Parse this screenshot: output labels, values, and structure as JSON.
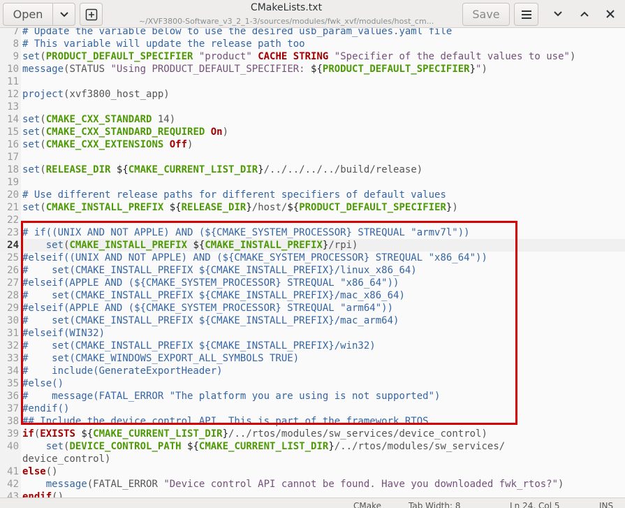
{
  "header": {
    "open_label": "Open",
    "title": "CMakeLists.txt",
    "subtitle": "~/XVF3800-Software_v3_2_1-3/sources/modules/fwk_xvf/modules/host_cm...",
    "save_label": "Save"
  },
  "status": {
    "language": "CMake",
    "tab_width": "Tab Width: 8",
    "position": "Ln 24, Col 5",
    "mode": "INS"
  },
  "editor": {
    "current_line": "24",
    "lines": [
      {
        "n": "7",
        "parts": [
          {
            "t": "c",
            "v": "# Update the variable below to use the desired usb_param_values.yaml file"
          }
        ]
      },
      {
        "n": "8",
        "parts": [
          {
            "t": "c",
            "v": "# This variable will update the release path too"
          }
        ]
      },
      {
        "n": "9",
        "parts": [
          {
            "t": "fn",
            "v": "set"
          },
          {
            "t": "p",
            "v": "("
          },
          {
            "t": "v",
            "v": "PRODUCT_DEFAULT_SPECIFIER"
          },
          {
            "t": "p",
            "v": " "
          },
          {
            "t": "s",
            "v": "\"product\""
          },
          {
            "t": "p",
            "v": " "
          },
          {
            "t": "kw",
            "v": "CACHE STRING"
          },
          {
            "t": "p",
            "v": " "
          },
          {
            "t": "s",
            "v": "\"Specifier of the default values to use\""
          },
          {
            "t": "p",
            "v": ")"
          }
        ]
      },
      {
        "n": "10",
        "parts": [
          {
            "t": "fn",
            "v": "message"
          },
          {
            "t": "p",
            "v": "(STATUS "
          },
          {
            "t": "s",
            "v": "\"Using PRODUCT_DEFAULT_SPECIFIER: "
          },
          {
            "t": "vt",
            "v": "${"
          },
          {
            "t": "v",
            "v": "PRODUCT_DEFAULT_SPECIFIER"
          },
          {
            "t": "vt",
            "v": "}"
          },
          {
            "t": "s",
            "v": "\""
          },
          {
            "t": "p",
            "v": ")"
          }
        ]
      },
      {
        "n": "11",
        "parts": []
      },
      {
        "n": "12",
        "parts": [
          {
            "t": "fn",
            "v": "project"
          },
          {
            "t": "p",
            "v": "(xvf3800_host_app)"
          }
        ]
      },
      {
        "n": "13",
        "parts": []
      },
      {
        "n": "14",
        "parts": [
          {
            "t": "fn",
            "v": "set"
          },
          {
            "t": "p",
            "v": "("
          },
          {
            "t": "v",
            "v": "CMAKE_CXX_STANDARD"
          },
          {
            "t": "p",
            "v": " 14)"
          }
        ]
      },
      {
        "n": "15",
        "parts": [
          {
            "t": "fn",
            "v": "set"
          },
          {
            "t": "p",
            "v": "("
          },
          {
            "t": "v",
            "v": "CMAKE_CXX_STANDARD_REQUIRED"
          },
          {
            "t": "p",
            "v": " "
          },
          {
            "t": "kw",
            "v": "On"
          },
          {
            "t": "p",
            "v": ")"
          }
        ]
      },
      {
        "n": "16",
        "parts": [
          {
            "t": "fn",
            "v": "set"
          },
          {
            "t": "p",
            "v": "("
          },
          {
            "t": "v",
            "v": "CMAKE_CXX_EXTENSIONS"
          },
          {
            "t": "p",
            "v": " "
          },
          {
            "t": "kw",
            "v": "Off"
          },
          {
            "t": "p",
            "v": ")"
          }
        ]
      },
      {
        "n": "17",
        "parts": []
      },
      {
        "n": "18",
        "parts": [
          {
            "t": "fn",
            "v": "set"
          },
          {
            "t": "p",
            "v": "("
          },
          {
            "t": "v",
            "v": "RELEASE_DIR"
          },
          {
            "t": "p",
            "v": " "
          },
          {
            "t": "vt",
            "v": "${"
          },
          {
            "t": "v",
            "v": "CMAKE_CURRENT_LIST_DIR"
          },
          {
            "t": "vt",
            "v": "}"
          },
          {
            "t": "p",
            "v": "/../../../../build/release)"
          }
        ]
      },
      {
        "n": "19",
        "parts": []
      },
      {
        "n": "20",
        "parts": [
          {
            "t": "c",
            "v": "# Use different release paths for different specifiers of default values"
          }
        ]
      },
      {
        "n": "21",
        "parts": [
          {
            "t": "fn",
            "v": "set"
          },
          {
            "t": "p",
            "v": "("
          },
          {
            "t": "v",
            "v": "CMAKE_INSTALL_PREFIX"
          },
          {
            "t": "p",
            "v": " "
          },
          {
            "t": "vt",
            "v": "${"
          },
          {
            "t": "v",
            "v": "RELEASE_DIR"
          },
          {
            "t": "vt",
            "v": "}"
          },
          {
            "t": "p",
            "v": "/host/"
          },
          {
            "t": "vt",
            "v": "${"
          },
          {
            "t": "v",
            "v": "PRODUCT_DEFAULT_SPECIFIER"
          },
          {
            "t": "vt",
            "v": "}"
          },
          {
            "t": "p",
            "v": ")"
          }
        ]
      },
      {
        "n": "22",
        "parts": []
      },
      {
        "n": "23",
        "parts": [
          {
            "t": "c",
            "v": "# if((UNIX AND NOT APPLE) AND (${CMAKE_SYSTEM_PROCESSOR} STREQUAL \"armv7l\"))"
          }
        ]
      },
      {
        "n": "24",
        "parts": [
          {
            "t": "p",
            "v": "    "
          },
          {
            "t": "fn",
            "v": "set"
          },
          {
            "t": "p",
            "v": "("
          },
          {
            "t": "v",
            "v": "CMAKE_INSTALL_PREFIX"
          },
          {
            "t": "p",
            "v": " "
          },
          {
            "t": "vt",
            "v": "${"
          },
          {
            "t": "v",
            "v": "CMAKE_INSTALL_PREFIX"
          },
          {
            "t": "vt",
            "v": "}"
          },
          {
            "t": "p",
            "v": "/rpi)"
          }
        ]
      },
      {
        "n": "25",
        "parts": [
          {
            "t": "c",
            "v": "#elseif((UNIX AND NOT APPLE) AND (${CMAKE_SYSTEM_PROCESSOR} STREQUAL \"x86_64\"))"
          }
        ]
      },
      {
        "n": "26",
        "parts": [
          {
            "t": "c",
            "v": "#    set(CMAKE_INSTALL_PREFIX ${CMAKE_INSTALL_PREFIX}/linux_x86_64)"
          }
        ]
      },
      {
        "n": "27",
        "parts": [
          {
            "t": "c",
            "v": "#elseif(APPLE AND (${CMAKE_SYSTEM_PROCESSOR} STREQUAL \"x86_64\"))"
          }
        ]
      },
      {
        "n": "28",
        "parts": [
          {
            "t": "c",
            "v": "#    set(CMAKE_INSTALL_PREFIX ${CMAKE_INSTALL_PREFIX}/mac_x86_64)"
          }
        ]
      },
      {
        "n": "29",
        "parts": [
          {
            "t": "c",
            "v": "#elseif(APPLE AND (${CMAKE_SYSTEM_PROCESSOR} STREQUAL \"arm64\"))"
          }
        ]
      },
      {
        "n": "30",
        "parts": [
          {
            "t": "c",
            "v": "#    set(CMAKE_INSTALL_PREFIX ${CMAKE_INSTALL_PREFIX}/mac_arm64)"
          }
        ]
      },
      {
        "n": "31",
        "parts": [
          {
            "t": "c",
            "v": "#elseif(WIN32)"
          }
        ]
      },
      {
        "n": "32",
        "parts": [
          {
            "t": "c",
            "v": "#    set(CMAKE_INSTALL_PREFIX ${CMAKE_INSTALL_PREFIX}/win32)"
          }
        ]
      },
      {
        "n": "33",
        "parts": [
          {
            "t": "c",
            "v": "#    set(CMAKE_WINDOWS_EXPORT_ALL_SYMBOLS TRUE)"
          }
        ]
      },
      {
        "n": "34",
        "parts": [
          {
            "t": "c",
            "v": "#    include(GenerateExportHeader)"
          }
        ]
      },
      {
        "n": "35",
        "parts": [
          {
            "t": "c",
            "v": "#else()"
          }
        ]
      },
      {
        "n": "36",
        "parts": [
          {
            "t": "c",
            "v": "#    message(FATAL_ERROR \"The platform you are using is not supported\")"
          }
        ]
      },
      {
        "n": "37",
        "parts": [
          {
            "t": "c",
            "v": "#endif()"
          }
        ]
      },
      {
        "n": "38",
        "parts": [
          {
            "t": "c",
            "v": "## Include the device control API. This is part of the framework RTOS."
          }
        ]
      },
      {
        "n": "39",
        "parts": [
          {
            "t": "kw",
            "v": "if"
          },
          {
            "t": "p",
            "v": "("
          },
          {
            "t": "kw",
            "v": "EXISTS"
          },
          {
            "t": "p",
            "v": " "
          },
          {
            "t": "vt",
            "v": "${"
          },
          {
            "t": "v",
            "v": "CMAKE_CURRENT_LIST_DIR"
          },
          {
            "t": "vt",
            "v": "}"
          },
          {
            "t": "p",
            "v": "/../rtos/modules/sw_services/device_control)"
          }
        ]
      },
      {
        "n": "40",
        "parts": [
          {
            "t": "p",
            "v": "    "
          },
          {
            "t": "fn",
            "v": "set"
          },
          {
            "t": "p",
            "v": "("
          },
          {
            "t": "v",
            "v": "DEVICE_CONTROL_PATH"
          },
          {
            "t": "p",
            "v": " "
          },
          {
            "t": "vt",
            "v": "${"
          },
          {
            "t": "v",
            "v": "CMAKE_CURRENT_LIST_DIR"
          },
          {
            "t": "vt",
            "v": "}"
          },
          {
            "t": "p",
            "v": "/../rtos/modules/sw_services/"
          }
        ]
      },
      {
        "n": "",
        "parts": [
          {
            "t": "p",
            "v": "device_control)"
          }
        ]
      },
      {
        "n": "41",
        "parts": [
          {
            "t": "kw",
            "v": "else"
          },
          {
            "t": "p",
            "v": "()"
          }
        ]
      },
      {
        "n": "42",
        "parts": [
          {
            "t": "p",
            "v": "    "
          },
          {
            "t": "fn",
            "v": "message"
          },
          {
            "t": "p",
            "v": "(FATAL_ERROR "
          },
          {
            "t": "s",
            "v": "\"Device control API cannot be found. Have you downloaded fwk_rtos?\""
          },
          {
            "t": "p",
            "v": ")"
          }
        ]
      },
      {
        "n": "43",
        "parts": [
          {
            "t": "kw",
            "v": "endif"
          },
          {
            "t": "p",
            "v": "()"
          }
        ]
      }
    ]
  }
}
